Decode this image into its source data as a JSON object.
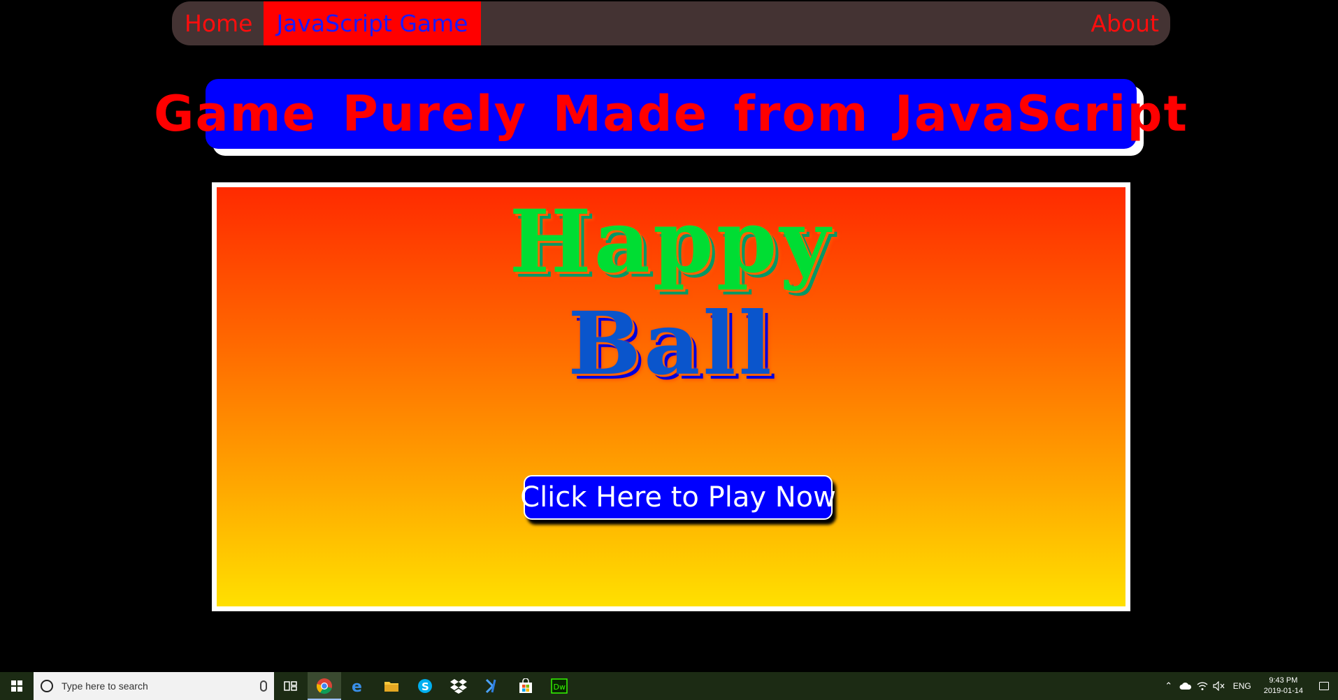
{
  "nav": {
    "home": "Home",
    "game": "JavaScript Game",
    "about": "About"
  },
  "banner": {
    "title": "Game Purely Made from JavaScript"
  },
  "game": {
    "title_line1": "Happy",
    "title_line2": "Ball",
    "play_button": "Click Here to Play Now"
  },
  "taskbar": {
    "search_placeholder": "Type here to search",
    "apps": [
      "task-view",
      "chrome",
      "edge",
      "file-explorer",
      "skype",
      "dropbox",
      "visual-studio-code",
      "store",
      "dreamweaver"
    ],
    "language": "ENG",
    "time": "9:43 PM",
    "date": "2019-01-14"
  },
  "colors": {
    "background": "#000000",
    "nav_bg": "#443333",
    "nav_text": "#ff0d0d",
    "nav_active_bg": "#ff0000",
    "nav_active_text": "#1a1aff",
    "banner_bg": "#0000ff",
    "banner_text": "#ff0000",
    "button_bg": "#0000ff"
  }
}
